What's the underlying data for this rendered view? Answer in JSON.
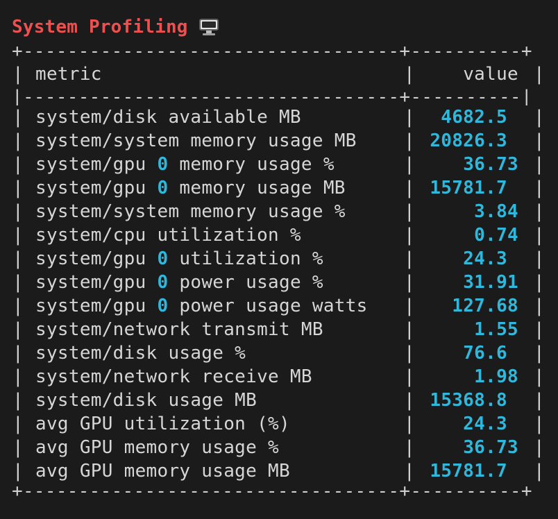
{
  "title": "System Profiling",
  "title_icon": "desktop-computer-icon",
  "colors": {
    "title": "#ef4f4f",
    "value": "#2fb8dc",
    "text": "#d6d6d6",
    "background": "#1b1b1b"
  },
  "table": {
    "border_top": "+----------------------------------+----------+",
    "separator": "|----------------------------------+----------|",
    "border_bottom": "+----------------------------------+----------+",
    "headers": {
      "metric": "metric",
      "value": "value"
    },
    "rows": [
      {
        "metric_prefix": "system/disk available MB",
        "gpu_index": "",
        "metric_suffix": "",
        "value": "4682.5",
        "align": "lg"
      },
      {
        "metric_prefix": "system/system memory usage MB",
        "gpu_index": "",
        "metric_suffix": "",
        "value": "20826.3",
        "align": "lg"
      },
      {
        "metric_prefix": "system/gpu ",
        "gpu_index": "0",
        "metric_suffix": " memory usage %",
        "value": "36.73",
        "align": "r"
      },
      {
        "metric_prefix": "system/gpu ",
        "gpu_index": "0",
        "metric_suffix": " memory usage MB",
        "value": "15781.7",
        "align": "lg"
      },
      {
        "metric_prefix": "system/system memory usage %",
        "gpu_index": "",
        "metric_suffix": "",
        "value": "3.84",
        "align": "r"
      },
      {
        "metric_prefix": "system/cpu utilization %",
        "gpu_index": "",
        "metric_suffix": "",
        "value": "0.74",
        "align": "r"
      },
      {
        "metric_prefix": "system/gpu ",
        "gpu_index": "0",
        "metric_suffix": " utilization %",
        "value": "24.3",
        "align": "lg"
      },
      {
        "metric_prefix": "system/gpu ",
        "gpu_index": "0",
        "metric_suffix": " power usage %",
        "value": "31.91",
        "align": "r"
      },
      {
        "metric_prefix": "system/gpu ",
        "gpu_index": "0",
        "metric_suffix": " power usage watts",
        "value": "127.68",
        "align": "r"
      },
      {
        "metric_prefix": "system/network transmit MB",
        "gpu_index": "",
        "metric_suffix": "",
        "value": "1.55",
        "align": "r"
      },
      {
        "metric_prefix": "system/disk usage %",
        "gpu_index": "",
        "metric_suffix": "",
        "value": "76.6",
        "align": "lg"
      },
      {
        "metric_prefix": "system/network receive MB",
        "gpu_index": "",
        "metric_suffix": "",
        "value": "1.98",
        "align": "r"
      },
      {
        "metric_prefix": "system/disk usage MB",
        "gpu_index": "",
        "metric_suffix": "",
        "value": "15368.8",
        "align": "lg"
      },
      {
        "metric_prefix": "avg GPU utilization (%)",
        "gpu_index": "",
        "metric_suffix": "",
        "value": "24.3",
        "align": "lg"
      },
      {
        "metric_prefix": "avg GPU memory usage %",
        "gpu_index": "",
        "metric_suffix": "",
        "value": "36.73",
        "align": "r"
      },
      {
        "metric_prefix": "avg GPU memory usage MB",
        "gpu_index": "",
        "metric_suffix": "",
        "value": "15781.7",
        "align": "lg"
      }
    ]
  }
}
